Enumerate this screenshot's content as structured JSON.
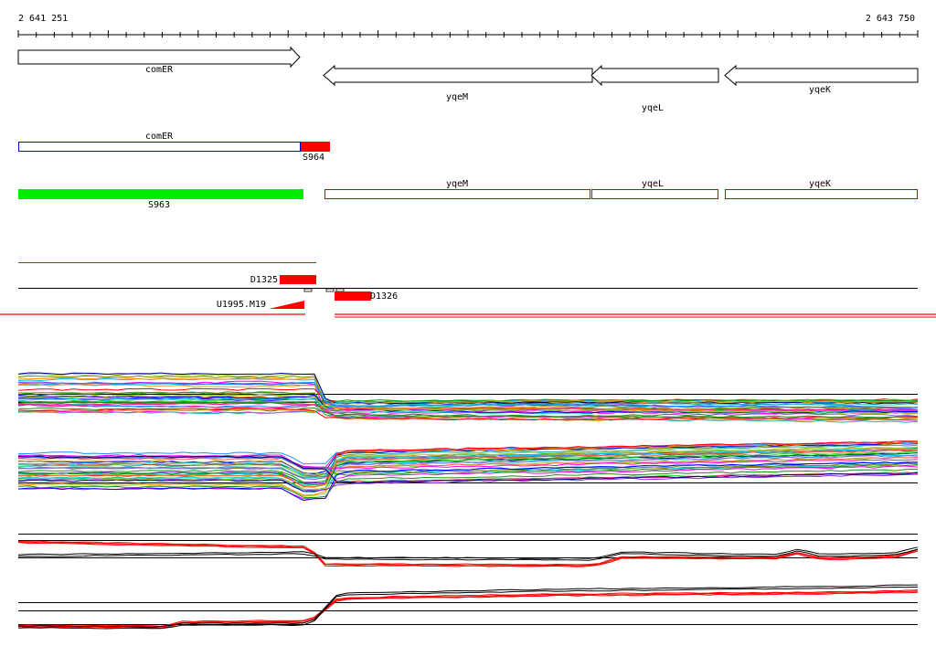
{
  "coords": {
    "start": "2 641 251",
    "end": "2 643 750"
  },
  "genes": [
    {
      "label": "comER",
      "strand": "+"
    },
    {
      "label": "yqeM",
      "strand": "-"
    },
    {
      "label": "yqeL",
      "strand": "-"
    },
    {
      "label": "yqeK",
      "strand": "-"
    }
  ],
  "transcripts": [
    {
      "label": "comER",
      "color": "#0000cc"
    },
    {
      "label": "S964",
      "color": "#ff0000"
    }
  ],
  "segments": [
    {
      "label": "S963",
      "color": "#00ee00"
    },
    {
      "label": "yqeM",
      "color": "#cc0000"
    },
    {
      "label": "yqeL",
      "color": "#cc0000"
    },
    {
      "label": "yqeK",
      "color": "#cc0000"
    }
  ],
  "features": [
    {
      "label": "D1325",
      "color": "#ff0000"
    },
    {
      "label": "D1326",
      "color": "#ff0000"
    },
    {
      "label": "U1995.M19",
      "color": "#ff0000"
    }
  ],
  "colors": {
    "accent": "#ff0000",
    "gene_outline": "#000000",
    "track_line": "#000000"
  },
  "profile_palette": [
    "#00a000",
    "#ff00ff",
    "#ff8c00",
    "#00ced1",
    "#0000ff",
    "#ff0000",
    "#808000",
    "#8a2be2",
    "#20b2aa",
    "#ff1493",
    "#228b22",
    "#daa520",
    "#1e90ff",
    "#9acd32",
    "#a0522d",
    "#00bfff",
    "#ff6347",
    "#7b68ee",
    "#32cd32",
    "#000080"
  ]
}
